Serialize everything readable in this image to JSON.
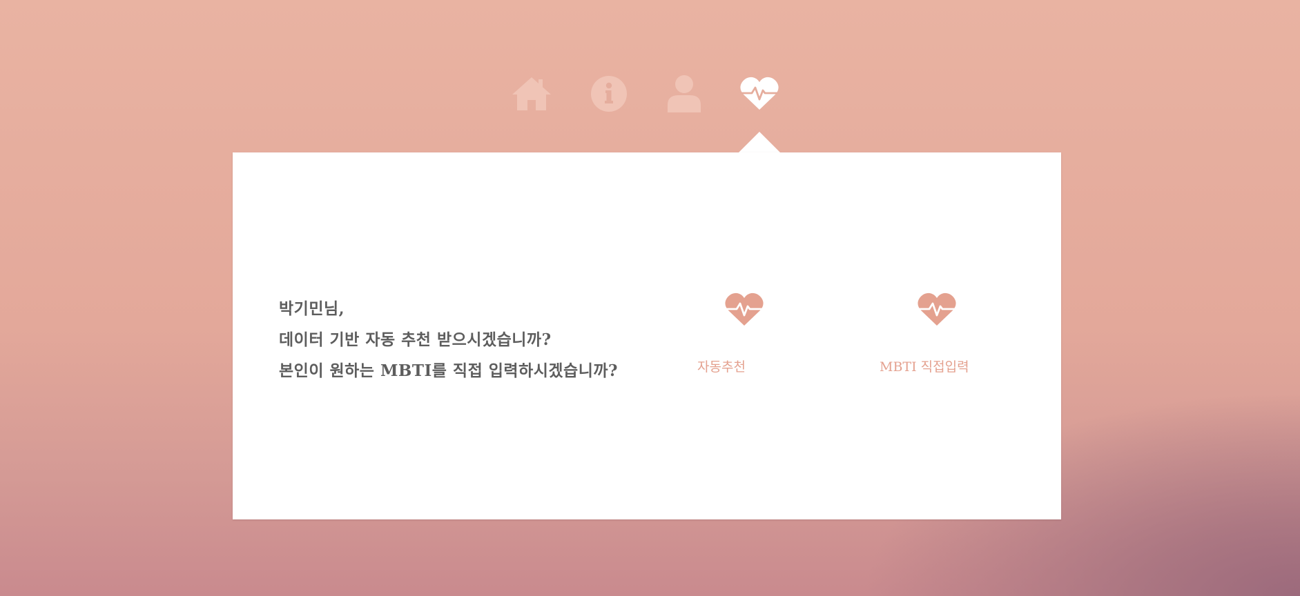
{
  "nav": {
    "items": [
      {
        "icon": "home-icon",
        "active": false
      },
      {
        "icon": "info-icon",
        "active": false
      },
      {
        "icon": "user-icon",
        "active": false
      },
      {
        "icon": "heartbeat-icon",
        "active": true
      }
    ]
  },
  "message": {
    "line1": "박기민님,",
    "line2": "데이터 기반 자동 추천 받으시겠습니까?",
    "line3": "본인이 원하는 MBTI를 직접 입력하시겠습니까?"
  },
  "options": {
    "auto_label": "자동추천",
    "auto_icon": "heartbeat-icon",
    "mbti_label": "MBTI 직접입력",
    "mbti_icon": "heartbeat-icon"
  },
  "colors": {
    "accent": "#e4a18f",
    "nav_inactive": "#f0c4b6",
    "nav_active": "#ffffff",
    "text": "#5d5d5d",
    "card": "#ffffff"
  }
}
